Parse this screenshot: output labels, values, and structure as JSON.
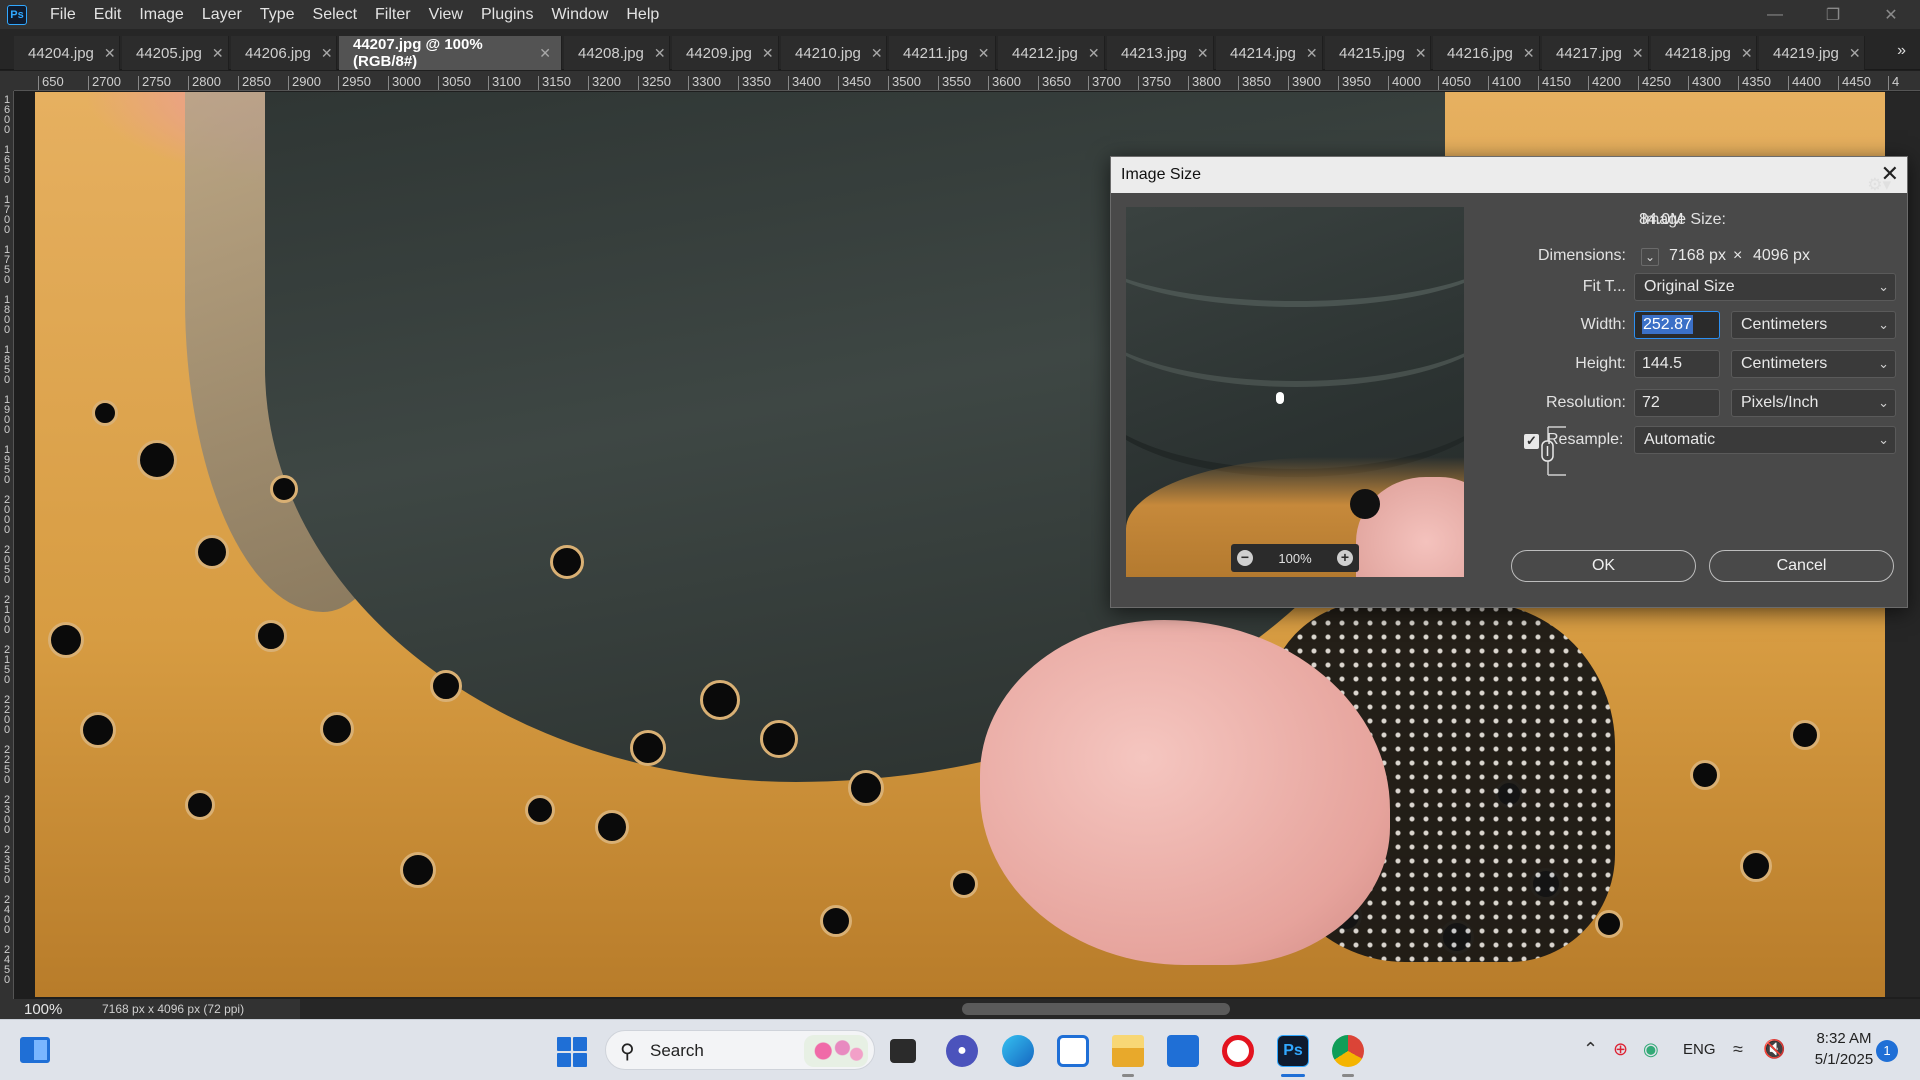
{
  "menubar": {
    "logo": "Ps",
    "items": [
      "File",
      "Edit",
      "Image",
      "Layer",
      "Type",
      "Select",
      "Filter",
      "View",
      "Plugins",
      "Window",
      "Help"
    ]
  },
  "tabs": [
    {
      "label": "44204.jpg",
      "active": false
    },
    {
      "label": "44205.jpg",
      "active": false
    },
    {
      "label": "44206.jpg",
      "active": false
    },
    {
      "label": "44207.jpg @ 100% (RGB/8#)",
      "active": true
    },
    {
      "label": "44208.jpg",
      "active": false
    },
    {
      "label": "44209.jpg",
      "active": false
    },
    {
      "label": "44210.jpg",
      "active": false
    },
    {
      "label": "44211.jpg",
      "active": false
    },
    {
      "label": "44212.jpg",
      "active": false
    },
    {
      "label": "44213.jpg",
      "active": false
    },
    {
      "label": "44214.jpg",
      "active": false
    },
    {
      "label": "44215.jpg",
      "active": false
    },
    {
      "label": "44216.jpg",
      "active": false
    },
    {
      "label": "44217.jpg",
      "active": false
    },
    {
      "label": "44218.jpg",
      "active": false
    },
    {
      "label": "44219.jpg",
      "active": false
    }
  ],
  "ruler_top": [
    "650",
    "2700",
    "2750",
    "2800",
    "2850",
    "2900",
    "2950",
    "3000",
    "3050",
    "3100",
    "3150",
    "3200",
    "3250",
    "3300",
    "3350",
    "3400",
    "3450",
    "3500",
    "3550",
    "3600",
    "3650",
    "3700",
    "3750",
    "3800",
    "3850",
    "3900",
    "3950",
    "4000",
    "4050",
    "4100",
    "4150",
    "4200",
    "4250",
    "4300",
    "4350",
    "4400",
    "4450",
    "4"
  ],
  "ruler_left": [
    "1600",
    "1650",
    "1700",
    "1750",
    "1800",
    "1850",
    "1900",
    "1950",
    "2000",
    "2050",
    "2100",
    "2150",
    "2200",
    "2250",
    "2300",
    "2350",
    "2400",
    "2450"
  ],
  "status": {
    "zoom": "100%",
    "doc_info": "7168 px x 4096 px (72 ppi)"
  },
  "dialog": {
    "title": "Image Size",
    "image_size_label": "Image Size:",
    "image_size_value": "84.0M",
    "dimensions_label": "Dimensions:",
    "dim_width": "7168 px",
    "dim_sep": "×",
    "dim_height": "4096 px",
    "fit_to_label": "Fit T...",
    "fit_to_value": "Original Size",
    "width_label": "Width:",
    "width_value": "252.87",
    "width_unit": "Centimeters",
    "height_label": "Height:",
    "height_value": "144.5",
    "height_unit": "Centimeters",
    "resolution_label": "Resolution:",
    "resolution_value": "72",
    "resolution_unit": "Pixels/Inch",
    "resample_label": "Resample:",
    "resample_checked": true,
    "resample_value": "Automatic",
    "preview_zoom": "100%",
    "ok_label": "OK",
    "cancel_label": "Cancel"
  },
  "taskbar": {
    "search_label": "Search",
    "language": "ENG",
    "time": "8:32 AM",
    "date": "5/1/2025",
    "notification_count": "1",
    "colors": {
      "accent": "#1f6fd6",
      "photoshop": "#31a8ff",
      "opera": "#e3131f"
    }
  }
}
